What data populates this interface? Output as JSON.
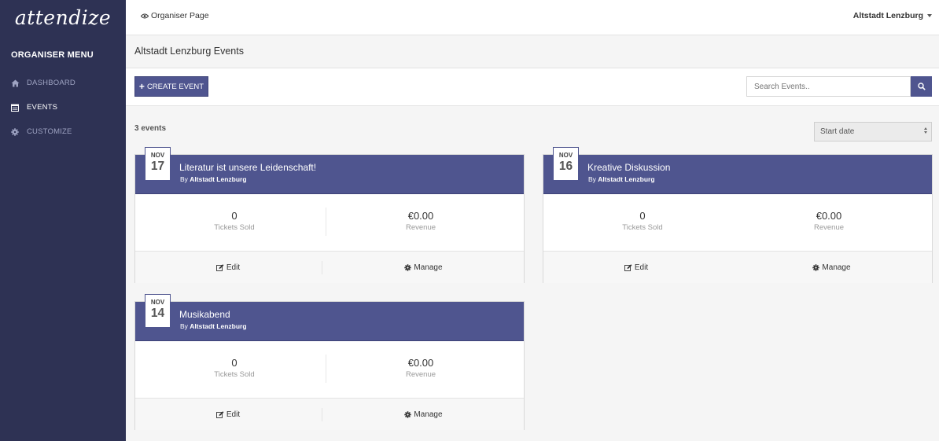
{
  "brand": "attendize",
  "sidebar": {
    "menu_title": "ORGANISER MENU",
    "items": [
      {
        "label": "DASHBOARD",
        "icon": "home-icon"
      },
      {
        "label": "EVENTS",
        "icon": "calendar-icon"
      },
      {
        "label": "CUSTOMIZE",
        "icon": "gear-icon"
      }
    ],
    "active": "EVENTS"
  },
  "topbar": {
    "organiser_page_label": "Organiser Page",
    "organiser_name": "Altstadt Lenzburg"
  },
  "page": {
    "title": "Altstadt Lenzburg Events"
  },
  "actions": {
    "create_label": "CREATE EVENT",
    "search_placeholder": "Search Events.."
  },
  "list": {
    "count_label": "3 events",
    "sort_selected": "Start date"
  },
  "events": [
    {
      "month": "NOV",
      "day": "17",
      "title": "Literatur ist unsere Leidenschaft!",
      "by_prefix": "By",
      "organiser": "Altstadt Lenzburg",
      "tickets_sold": "0",
      "tickets_label": "Tickets Sold",
      "revenue": "€0.00",
      "revenue_label": "Revenue",
      "edit_label": "Edit",
      "manage_label": "Manage"
    },
    {
      "month": "NOV",
      "day": "16",
      "title": "Kreative Diskussion",
      "by_prefix": "By",
      "organiser": "Altstadt Lenzburg",
      "tickets_sold": "0",
      "tickets_label": "Tickets Sold",
      "revenue": "€0.00",
      "revenue_label": "Revenue",
      "edit_label": "Edit",
      "manage_label": "Manage"
    },
    {
      "month": "NOV",
      "day": "14",
      "title": "Musikabend",
      "by_prefix": "By",
      "organiser": "Altstadt Lenzburg",
      "tickets_sold": "0",
      "tickets_label": "Tickets Sold",
      "revenue": "€0.00",
      "revenue_label": "Revenue",
      "edit_label": "Edit",
      "manage_label": "Manage"
    }
  ],
  "colors": {
    "sidebar_bg": "#2e3254",
    "accent": "#4f558f",
    "nav_inactive": "#9ea3c2"
  }
}
